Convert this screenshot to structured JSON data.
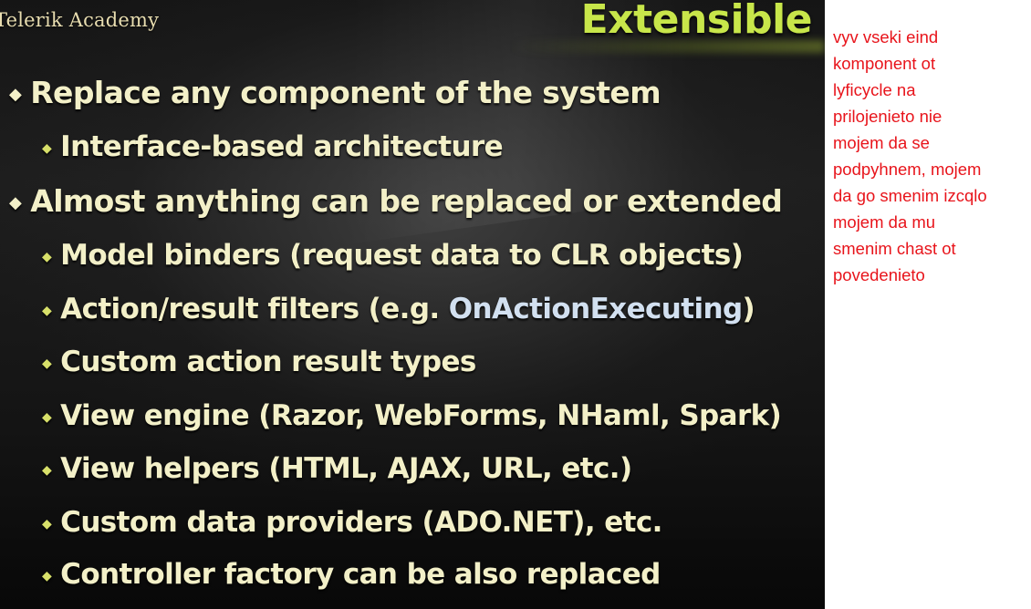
{
  "slide": {
    "logo_text": "Telerik Academy",
    "title": "Extensible",
    "bullets": [
      {
        "level": 1,
        "text": "Replace any component of the system"
      },
      {
        "level": 2,
        "text": "Interface-based architecture"
      },
      {
        "level": 1,
        "text": "Almost anything can be replaced or extended"
      },
      {
        "level": 2,
        "text": "Model binders (request data to CLR objects)"
      },
      {
        "level": 2,
        "text_before": "Action/result filters (e.g. ",
        "highlight": "OnActionExecuting",
        "text_after": ")"
      },
      {
        "level": 2,
        "text": "Custom action result types"
      },
      {
        "level": 2,
        "text": "View engine (Razor, WebForms, NHaml, Spark)"
      },
      {
        "level": 2,
        "text": "View helpers (HTML, AJAX, URL, etc.)"
      },
      {
        "level": 2,
        "text": "Custom data providers (ADO.NET), etc."
      },
      {
        "level": 2,
        "text": "Controller factory can be also replaced"
      }
    ],
    "bullet_icon": "diamond-bullet-icon"
  },
  "note": {
    "lines": [
      "vyv vseki eind",
      "komponent ot",
      "lyficycle na",
      "prilojenieto nie",
      "mojem da se",
      "podpyhnem, mojem",
      "da go smenim izcqlo",
      "mojem da mu",
      "smenim chast ot",
      "povedenieto"
    ],
    "color": "#e8141b"
  },
  "colors": {
    "title": "#c8e64a",
    "bullet_text": "#f3f0c8",
    "highlight": "#d2e0f0",
    "slide_background": "#1a1a1a"
  }
}
